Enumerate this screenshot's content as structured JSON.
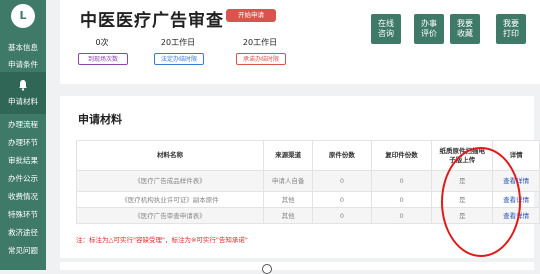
{
  "sidebar": {
    "logo": "L",
    "items": [
      {
        "label": "基本信息"
      },
      {
        "label": "申请条件"
      },
      {
        "label": "申请材料"
      },
      {
        "label": "办理流程"
      },
      {
        "label": "办理环节"
      },
      {
        "label": "审批结果"
      },
      {
        "label": "办件公示"
      },
      {
        "label": "收费情况"
      },
      {
        "label": "特殊环节"
      },
      {
        "label": "救济途径"
      },
      {
        "label": "常见问题"
      }
    ]
  },
  "header": {
    "title": "中医医疗广告审查",
    "start_button": "开始申请",
    "stats": [
      {
        "value": "0次",
        "tag": "到现场次数",
        "tag_color": "#8e44ad"
      },
      {
        "value": "20工作日",
        "tag": "法定办结时限",
        "tag_color": "#3a7bd5"
      },
      {
        "value": "20工作日",
        "tag": "承诺办结时限",
        "tag_color": "#d9534f"
      }
    ],
    "buttons": [
      {
        "line1": "在线",
        "line2": "咨询"
      },
      {
        "line1": "办事",
        "line2": "评价"
      },
      {
        "line1": "我要",
        "line2": "收藏"
      },
      {
        "line1": "我要",
        "line2": "打印"
      }
    ]
  },
  "materials": {
    "title": "申请材料",
    "headers": [
      "材料名称",
      "来源渠道",
      "原件份数",
      "复印件份数",
      "纸质原件扫描电子版上传",
      "详情"
    ],
    "rows": [
      [
        "《医疗广告成品样件表》",
        "申请人自备",
        "0",
        "0",
        "是",
        "查看详情"
      ],
      [
        "《医疗机构执业许可证》副本原件",
        "其他",
        "0",
        "0",
        "是",
        "查看详情"
      ],
      [
        "《医疗广告审查申请表》",
        "其他",
        "0",
        "0",
        "是",
        "查看详情"
      ]
    ],
    "note": "注：标注为△可实行\"容缺受理\"，标注为※可实行\"告知承诺\""
  }
}
